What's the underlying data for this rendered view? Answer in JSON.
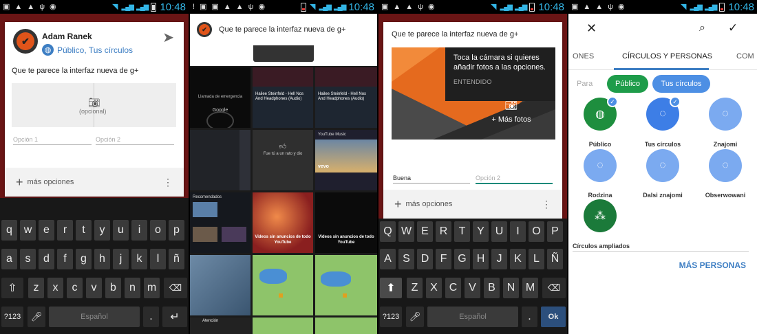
{
  "status_bar": {
    "time": "10:48"
  },
  "panel1": {
    "user_name": "Adam Ranek",
    "audience": "Público, Tus círculos",
    "post_text": "Que te parece la interfaz nueva de g+",
    "photo_optional": "(opcional)",
    "option1_placeholder": "Opción 1",
    "option2_placeholder": "Opción 2",
    "more_options": "más opciones"
  },
  "keyboard_es": {
    "row1": [
      "q",
      "w",
      "e",
      "r",
      "t",
      "y",
      "u",
      "i",
      "o",
      "p"
    ],
    "row2": [
      "a",
      "s",
      "d",
      "f",
      "g",
      "h",
      "j",
      "k",
      "l",
      "ñ"
    ],
    "row3": [
      "z",
      "x",
      "c",
      "v",
      "b",
      "n",
      "m"
    ],
    "num_key": "?123",
    "space_label": "Español",
    "period": "."
  },
  "panel2": {
    "post_text": "Que te parece la interfaz nueva de g+",
    "thumb_emergency": "Llamada de emergencia",
    "thumb_google": "Google",
    "thumb_song_title": "Hailee Steinfeld - Hell Nos And Headphones (Audio)",
    "thumb_notify": "Fue tú a un rato y dio",
    "thumb_ytmusic": "YouTube Music",
    "thumb_vevo": "vevo",
    "thumb_recomendados": "Recomendados",
    "thumb_videos_ads": "Videos sin anuncios de todo YouTube",
    "thumb_attention": "Atención"
  },
  "panel3": {
    "post_text": "Que te parece la interfaz nueva de g+",
    "tooltip_text": "Toca la cámara si quieres añadir fotos a las opciones.",
    "tooltip_button": "ENTENDIDO",
    "add_photos": "+ Más fotos",
    "option1_value": "Buena",
    "option2_placeholder": "Opción 2",
    "more_options": "más opciones"
  },
  "keyboard_es_caps": {
    "row1": [
      "Q",
      "W",
      "E",
      "R",
      "T",
      "Y",
      "U",
      "I",
      "O",
      "P"
    ],
    "row2": [
      "A",
      "S",
      "D",
      "F",
      "G",
      "H",
      "J",
      "K",
      "L",
      "Ñ"
    ],
    "row3": [
      "Z",
      "X",
      "C",
      "V",
      "B",
      "N",
      "M"
    ],
    "num_key": "?123",
    "space_label": "Español",
    "period": ".",
    "ok": "Ok"
  },
  "panel4": {
    "tab_left": "ONES",
    "tab_active": "CÍRCULOS Y PERSONAS",
    "tab_right": "COM",
    "para": "Para",
    "chip_public": "Público",
    "chip_circles": "Tus círculos",
    "circles": [
      {
        "label": "Público",
        "color": "#1e8e3e",
        "checked": true,
        "icon": "globe-icon"
      },
      {
        "label": "Tus círculos",
        "color": "#3d7ee6",
        "checked": true,
        "icon": "circles-icon"
      },
      {
        "label": "Znajomi",
        "color": "#7baaf0",
        "checked": false,
        "icon": "circles-icon"
      },
      {
        "label": "Rodzina",
        "color": "#7baaf0",
        "checked": false,
        "icon": "circles-icon"
      },
      {
        "label": "Dalsi znajomi",
        "color": "#7baaf0",
        "checked": false,
        "icon": "circles-icon"
      },
      {
        "label": "Obserwowani",
        "color": "#7baaf0",
        "checked": false,
        "icon": "circles-icon"
      },
      {
        "label": "Círculos ampliados",
        "color": "#1b7a3a",
        "checked": false,
        "icon": "extended-circles-icon"
      }
    ],
    "extended_label": "Círculos ampliados",
    "more_people": "MÁS PERSONAS"
  },
  "colors": {
    "accent": "#3d7ec3",
    "brand_orange": "#e0541a",
    "chip_green": "#1e9c4a",
    "chip_blue": "#4d8fe4"
  }
}
